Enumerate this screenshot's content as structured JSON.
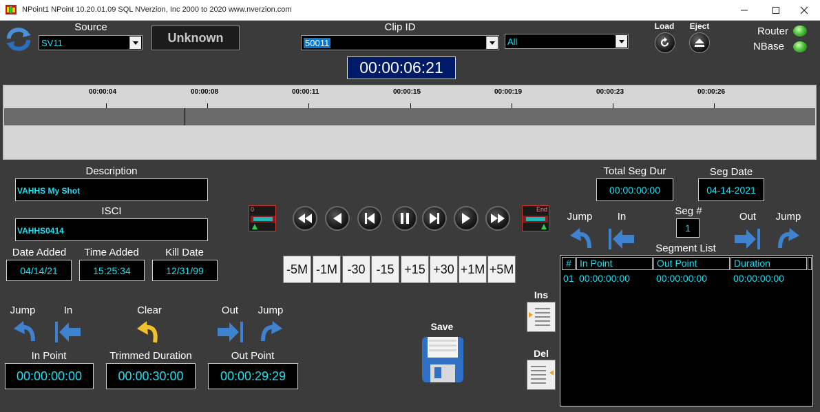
{
  "window": {
    "title": "NPoint1 NPoint 10.20.01.09 SQL   NVerzion, Inc 2000 to 2020  www.nverzion.com",
    "controls": [
      "minimize",
      "maximize",
      "close"
    ]
  },
  "header": {
    "source_label": "Source",
    "source_value": "SV11",
    "status_label": "Unknown",
    "clip_id_label": "Clip ID",
    "clip_id_value": "50011",
    "filter_value": "All",
    "main_timecode": "00:00:06:21",
    "load_label": "Load",
    "eject_label": "Eject",
    "router_label": "Router",
    "nbase_label": "NBase"
  },
  "timeline": {
    "ticks": [
      "00:00:04",
      "00:00:08",
      "00:00:11",
      "00:00:15",
      "00:00:19",
      "00:00:23",
      "00:00:26"
    ]
  },
  "clip_info": {
    "description_label": "Description",
    "description_value": "VAHHS My Shot",
    "isci_label": "ISCI",
    "isci_value": "VAHHS0414",
    "date_added_label": "Date Added",
    "date_added_value": "04/14/21",
    "time_added_label": "Time Added",
    "time_added_value": "15:25:34",
    "kill_date_label": "Kill Date",
    "kill_date_value": "12/31/99"
  },
  "transport": {
    "start_marker": "0",
    "end_marker": "End",
    "steps": [
      "-5M",
      "-1M",
      "-30",
      "-15",
      "+15",
      "+30",
      "+1M",
      "+5M"
    ]
  },
  "trim": {
    "jump_label": "Jump",
    "in_label": "In",
    "clear_label": "Clear",
    "out_label": "Out",
    "jump2_label": "Jump",
    "in_point_label": "In Point",
    "in_point_value": "00:00:00:00",
    "trimmed_label": "Trimmed Duration",
    "trimmed_value": "00:00:30:00",
    "out_point_label": "Out Point",
    "out_point_value": "00:00:29:29",
    "save_label": "Save"
  },
  "segments": {
    "total_seg_dur_label": "Total Seg Dur",
    "total_seg_dur_value": "00:00:00:00",
    "seg_date_label": "Seg Date",
    "seg_date_value": "04-14-2021",
    "seg_num_label": "Seg #",
    "seg_num_value": "1",
    "jump_label": "Jump",
    "in_label": "In",
    "out_label": "Out",
    "jump2_label": "Jump",
    "list_label": "Segment List",
    "ins_label": "Ins",
    "del_label": "Del",
    "columns": [
      "#",
      "In Point",
      "Out Point",
      "Duration"
    ],
    "rows": [
      {
        "num": "01",
        "in": "00:00:00:00",
        "out": "00:00:00:00",
        "dur": "00:00:00:00"
      }
    ]
  },
  "colors": {
    "background": "#3b3b3b",
    "text_cyan": "#19e0f0",
    "selection_blue": "#0078d7",
    "led_green": "#4ec23c"
  }
}
